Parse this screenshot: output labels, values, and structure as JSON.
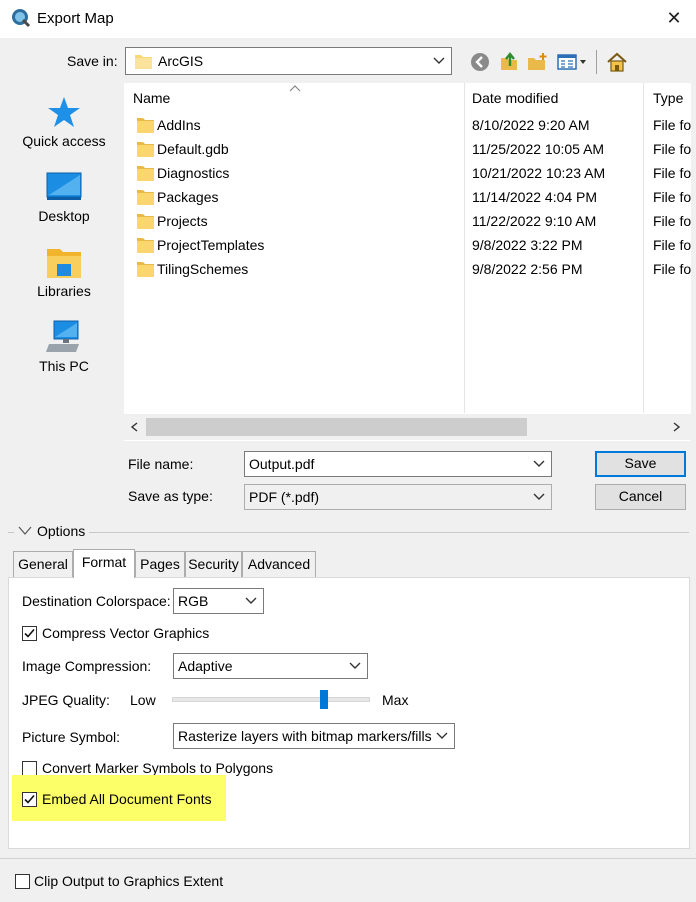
{
  "window": {
    "title": "Export Map",
    "close": "✕"
  },
  "savein": {
    "label": "Save in:",
    "value": "ArcGIS"
  },
  "places": [
    {
      "label": "Quick access",
      "icon": "quick-access-icon"
    },
    {
      "label": "Desktop",
      "icon": "desktop-icon"
    },
    {
      "label": "Libraries",
      "icon": "libraries-icon"
    },
    {
      "label": "This PC",
      "icon": "this-pc-icon"
    }
  ],
  "filelist": {
    "columns": [
      "Name",
      "Date modified",
      "Type"
    ],
    "rows": [
      {
        "name": "AddIns",
        "date": "8/10/2022 9:20 AM",
        "type": "File fo"
      },
      {
        "name": "Default.gdb",
        "date": "11/25/2022 10:05 AM",
        "type": "File fo"
      },
      {
        "name": "Diagnostics",
        "date": "10/21/2022 10:23 AM",
        "type": "File fo"
      },
      {
        "name": "Packages",
        "date": "11/14/2022 4:04 PM",
        "type": "File fo"
      },
      {
        "name": "Projects",
        "date": "11/22/2022 9:10 AM",
        "type": "File fo"
      },
      {
        "name": "ProjectTemplates",
        "date": "9/8/2022 3:22 PM",
        "type": "File fo"
      },
      {
        "name": "TilingSchemes",
        "date": "9/8/2022 2:56 PM",
        "type": "File fo"
      }
    ]
  },
  "filename": {
    "label": "File name:",
    "value": "Output.pdf"
  },
  "savetype": {
    "label": "Save as type:",
    "value": "PDF (*.pdf)"
  },
  "buttons": {
    "save": "Save",
    "cancel": "Cancel"
  },
  "options": {
    "label": "Options",
    "tabs": [
      "General",
      "Format",
      "Pages",
      "Security",
      "Advanced"
    ],
    "active_tab": "Format"
  },
  "format": {
    "colorspace_label": "Destination Colorspace:",
    "colorspace_value": "RGB",
    "compress_vector_label": "Compress Vector Graphics",
    "compress_vector_checked": true,
    "image_compression_label": "Image Compression:",
    "image_compression_value": "Adaptive",
    "jpeg_label": "JPEG Quality:",
    "jpeg_low": "Low",
    "jpeg_max": "Max",
    "jpeg_level": 0.77,
    "picture_symbol_label": "Picture Symbol:",
    "picture_symbol_value": "Rasterize layers with bitmap markers/fills",
    "convert_marker_label": "Convert Marker Symbols to Polygons",
    "convert_marker_checked": false,
    "embed_fonts_label": "Embed All Document Fonts",
    "embed_fonts_checked": true,
    "highlight_color": "#fcff67"
  },
  "clip_output": {
    "label": "Clip Output to Graphics Extent",
    "checked": false
  },
  "colors": {
    "accent": "#0078d7",
    "folder": "#f8d775"
  }
}
